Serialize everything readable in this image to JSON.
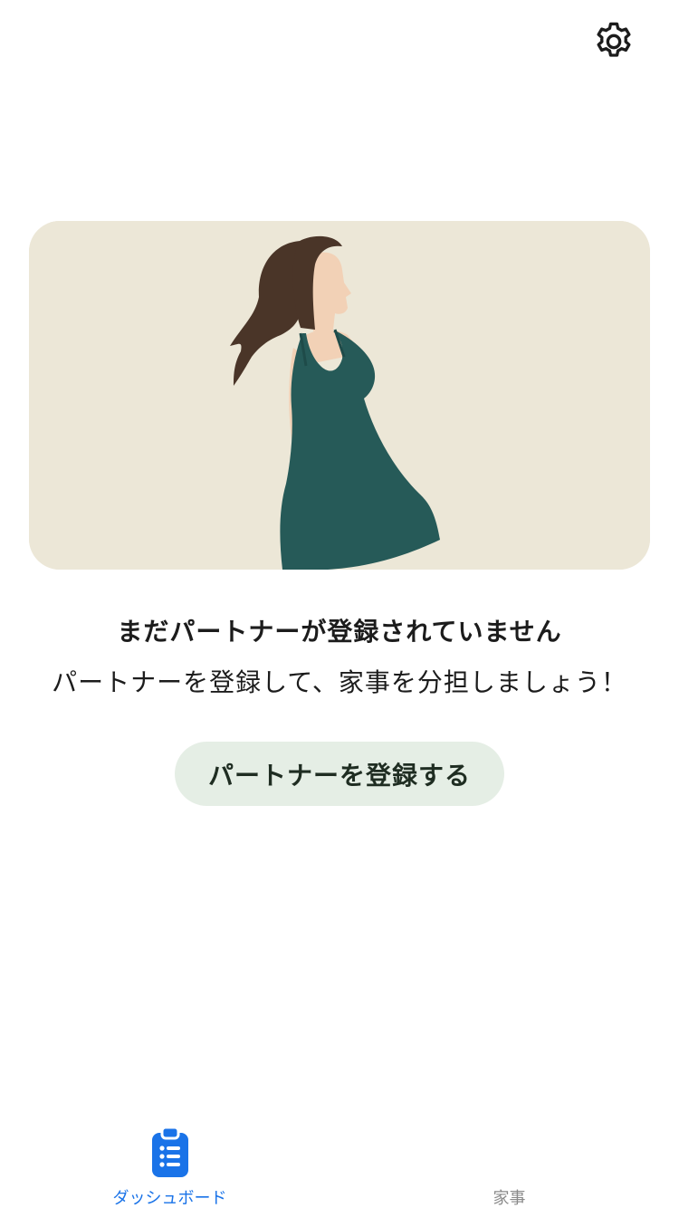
{
  "header": {
    "settings_icon": "gear-icon"
  },
  "hero": {
    "illustration": "woman-in-green-dress",
    "colors": {
      "background": "#ece7d7",
      "dress": "#265a58",
      "hair": "#4a3528",
      "skin": "#f2d1b6"
    }
  },
  "empty_state": {
    "title": "まだパートナーが登録されていません",
    "subtitle": "パートナーを登録して、家事を分担しましょう！"
  },
  "actions": {
    "register_label": "パートナーを登録する",
    "register_bg": "#e5eee5"
  },
  "tabbar": {
    "tabs": [
      {
        "label": "ダッシュボード",
        "icon": "clipboard-list-icon",
        "active": true
      },
      {
        "label": "家事",
        "icon": "",
        "active": false
      }
    ],
    "active_color": "#1a73e8",
    "inactive_color": "#8a8a8a"
  }
}
